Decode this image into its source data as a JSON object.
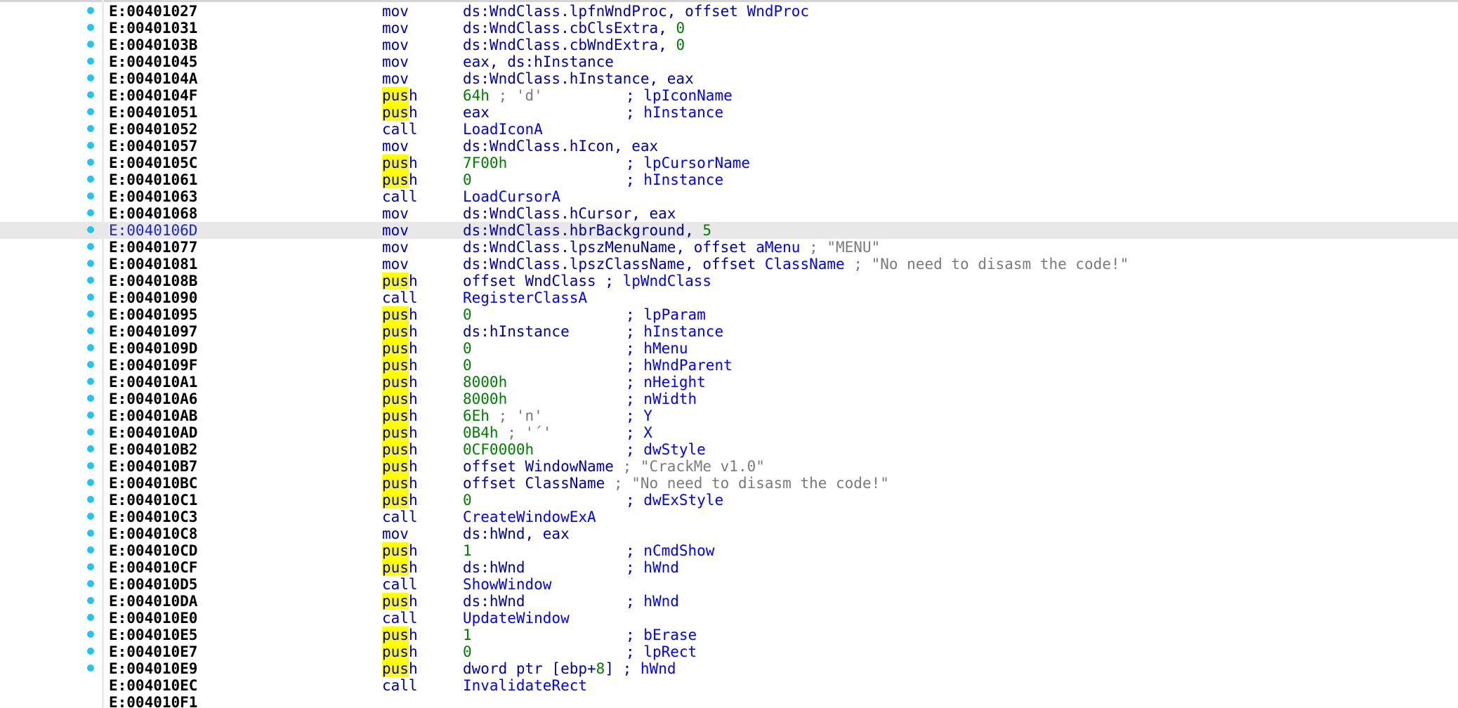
{
  "colors": {
    "background": "#ffffff",
    "selected_row": "#e8e8e8",
    "address": "#000000",
    "selected_address": "#1a25d6",
    "mnemonic": "#0000a8",
    "search_highlight": "#ffff00",
    "number": "#007d00",
    "symbol": "#0000ff",
    "comment": "#7a7a7a",
    "breakpoint_dot": "#23c4f2"
  },
  "highlight_term": "pus",
  "rows": [
    {
      "addr": "E:00401027",
      "dot": true,
      "mn": "mov",
      "ops": [
        [
          "p",
          "ds:WndClass.lpfnWndProc, offset "
        ],
        [
          "s",
          "WndProc"
        ]
      ]
    },
    {
      "addr": "E:00401031",
      "dot": true,
      "mn": "mov",
      "ops": [
        [
          "p",
          "ds:WndClass.cbClsExtra, "
        ],
        [
          "n",
          "0"
        ]
      ]
    },
    {
      "addr": "E:0040103B",
      "dot": true,
      "mn": "mov",
      "ops": [
        [
          "p",
          "ds:WndClass.cbWndExtra, "
        ],
        [
          "n",
          "0"
        ]
      ]
    },
    {
      "addr": "E:00401045",
      "dot": true,
      "mn": "mov",
      "ops": [
        [
          "p",
          "eax, ds:hInstance"
        ]
      ]
    },
    {
      "addr": "E:0040104A",
      "dot": true,
      "mn": "mov",
      "ops": [
        [
          "p",
          "ds:WndClass.hInstance, eax"
        ]
      ]
    },
    {
      "addr": "E:0040104F",
      "dot": true,
      "mn": "push",
      "ops": [
        [
          "n",
          "64h"
        ],
        [
          "g",
          " ; 'd'"
        ]
      ],
      "cmt": [
        [
          "p",
          "; "
        ],
        [
          "s",
          "lpIconName"
        ]
      ]
    },
    {
      "addr": "E:00401051",
      "dot": true,
      "mn": "push",
      "ops": [
        [
          "p",
          "eax"
        ]
      ],
      "cmt": [
        [
          "p",
          "; "
        ],
        [
          "s",
          "hInstance"
        ]
      ]
    },
    {
      "addr": "E:00401052",
      "dot": true,
      "mn": "call",
      "ops": [
        [
          "s",
          "LoadIconA"
        ]
      ]
    },
    {
      "addr": "E:00401057",
      "dot": true,
      "mn": "mov",
      "ops": [
        [
          "p",
          "ds:WndClass.hIcon, eax"
        ]
      ]
    },
    {
      "addr": "E:0040105C",
      "dot": true,
      "mn": "push",
      "ops": [
        [
          "n",
          "7F00h"
        ]
      ],
      "cmt": [
        [
          "p",
          "; "
        ],
        [
          "s",
          "lpCursorName"
        ]
      ]
    },
    {
      "addr": "E:00401061",
      "dot": true,
      "mn": "push",
      "ops": [
        [
          "n",
          "0"
        ]
      ],
      "cmt": [
        [
          "p",
          "; "
        ],
        [
          "s",
          "hInstance"
        ]
      ]
    },
    {
      "addr": "E:00401063",
      "dot": true,
      "mn": "call",
      "ops": [
        [
          "s",
          "LoadCursorA"
        ]
      ]
    },
    {
      "addr": "E:00401068",
      "dot": true,
      "mn": "mov",
      "ops": [
        [
          "p",
          "ds:WndClass.hCursor, eax"
        ]
      ]
    },
    {
      "addr": "E:0040106D",
      "dot": true,
      "selected": true,
      "mn": "mov",
      "ops": [
        [
          "p",
          "ds:WndClass.hbrBackground, "
        ],
        [
          "n",
          "5"
        ]
      ]
    },
    {
      "addr": "E:00401077",
      "dot": true,
      "mn": "mov",
      "ops": [
        [
          "p",
          "ds:WndClass.lpszMenuName, offset "
        ],
        [
          "s",
          "aMenu"
        ],
        [
          "g",
          " ; \"MENU\""
        ]
      ]
    },
    {
      "addr": "E:00401081",
      "dot": true,
      "mn": "mov",
      "ops": [
        [
          "p",
          "ds:WndClass.lpszClassName, offset "
        ],
        [
          "s",
          "ClassName"
        ],
        [
          "g",
          " ; \"No need to disasm the code!\""
        ]
      ]
    },
    {
      "addr": "E:0040108B",
      "dot": true,
      "mn": "push",
      "ops": [
        [
          "p",
          "offset WndClass "
        ],
        [
          "p",
          "; "
        ],
        [
          "s",
          "lpWndClass"
        ]
      ]
    },
    {
      "addr": "E:00401090",
      "dot": true,
      "mn": "call",
      "ops": [
        [
          "s",
          "RegisterClassA"
        ]
      ]
    },
    {
      "addr": "E:00401095",
      "dot": true,
      "mn": "push",
      "ops": [
        [
          "n",
          "0"
        ]
      ],
      "cmt": [
        [
          "p",
          "; "
        ],
        [
          "s",
          "lpParam"
        ]
      ]
    },
    {
      "addr": "E:00401097",
      "dot": true,
      "mn": "push",
      "ops": [
        [
          "p",
          "ds:hInstance"
        ]
      ],
      "cmt": [
        [
          "p",
          "; "
        ],
        [
          "s",
          "hInstance"
        ]
      ]
    },
    {
      "addr": "E:0040109D",
      "dot": true,
      "mn": "push",
      "ops": [
        [
          "n",
          "0"
        ]
      ],
      "cmt": [
        [
          "p",
          "; "
        ],
        [
          "s",
          "hMenu"
        ]
      ]
    },
    {
      "addr": "E:0040109F",
      "dot": true,
      "mn": "push",
      "ops": [
        [
          "n",
          "0"
        ]
      ],
      "cmt": [
        [
          "p",
          "; "
        ],
        [
          "s",
          "hWndParent"
        ]
      ]
    },
    {
      "addr": "E:004010A1",
      "dot": true,
      "mn": "push",
      "ops": [
        [
          "n",
          "8000h"
        ]
      ],
      "cmt": [
        [
          "p",
          "; "
        ],
        [
          "s",
          "nHeight"
        ]
      ]
    },
    {
      "addr": "E:004010A6",
      "dot": true,
      "mn": "push",
      "ops": [
        [
          "n",
          "8000h"
        ]
      ],
      "cmt": [
        [
          "p",
          "; "
        ],
        [
          "s",
          "nWidth"
        ]
      ]
    },
    {
      "addr": "E:004010AB",
      "dot": true,
      "mn": "push",
      "ops": [
        [
          "n",
          "6Eh"
        ],
        [
          "g",
          " ; 'n'"
        ]
      ],
      "cmt": [
        [
          "p",
          "; "
        ],
        [
          "s",
          "Y"
        ]
      ]
    },
    {
      "addr": "E:004010AD",
      "dot": true,
      "mn": "push",
      "ops": [
        [
          "n",
          "0B4h"
        ],
        [
          "g",
          " ; '´'"
        ]
      ],
      "cmt": [
        [
          "p",
          "; "
        ],
        [
          "s",
          "X"
        ]
      ]
    },
    {
      "addr": "E:004010B2",
      "dot": true,
      "mn": "push",
      "ops": [
        [
          "n",
          "0CF0000h"
        ]
      ],
      "cmt": [
        [
          "p",
          "; "
        ],
        [
          "s",
          "dwStyle"
        ]
      ]
    },
    {
      "addr": "E:004010B7",
      "dot": true,
      "mn": "push",
      "ops": [
        [
          "p",
          "offset WindowName"
        ],
        [
          "g",
          " ; \"CrackMe v1.0\""
        ]
      ]
    },
    {
      "addr": "E:004010BC",
      "dot": true,
      "mn": "push",
      "ops": [
        [
          "p",
          "offset ClassName"
        ],
        [
          "g",
          " ; \"No need to disasm the code!\""
        ]
      ]
    },
    {
      "addr": "E:004010C1",
      "dot": true,
      "mn": "push",
      "ops": [
        [
          "n",
          "0"
        ]
      ],
      "cmt": [
        [
          "p",
          "; "
        ],
        [
          "s",
          "dwExStyle"
        ]
      ]
    },
    {
      "addr": "E:004010C3",
      "dot": true,
      "mn": "call",
      "ops": [
        [
          "s",
          "CreateWindowExA"
        ]
      ]
    },
    {
      "addr": "E:004010C8",
      "dot": true,
      "mn": "mov",
      "ops": [
        [
          "p",
          "ds:hWnd, eax"
        ]
      ]
    },
    {
      "addr": "E:004010CD",
      "dot": true,
      "mn": "push",
      "ops": [
        [
          "n",
          "1"
        ]
      ],
      "cmt": [
        [
          "p",
          "; "
        ],
        [
          "s",
          "nCmdShow"
        ]
      ]
    },
    {
      "addr": "E:004010CF",
      "dot": true,
      "mn": "push",
      "ops": [
        [
          "p",
          "ds:hWnd"
        ]
      ],
      "cmt": [
        [
          "p",
          "; "
        ],
        [
          "s",
          "hWnd"
        ]
      ]
    },
    {
      "addr": "E:004010D5",
      "dot": true,
      "mn": "call",
      "ops": [
        [
          "s",
          "ShowWindow"
        ]
      ]
    },
    {
      "addr": "E:004010DA",
      "dot": true,
      "mn": "push",
      "ops": [
        [
          "p",
          "ds:hWnd"
        ]
      ],
      "cmt": [
        [
          "p",
          "; "
        ],
        [
          "s",
          "hWnd"
        ]
      ]
    },
    {
      "addr": "E:004010E0",
      "dot": true,
      "mn": "call",
      "ops": [
        [
          "s",
          "UpdateWindow"
        ]
      ]
    },
    {
      "addr": "E:004010E5",
      "dot": true,
      "mn": "push",
      "ops": [
        [
          "n",
          "1"
        ]
      ],
      "cmt": [
        [
          "p",
          "; "
        ],
        [
          "s",
          "bErase"
        ]
      ]
    },
    {
      "addr": "E:004010E7",
      "dot": true,
      "mn": "push",
      "ops": [
        [
          "n",
          "0"
        ]
      ],
      "cmt": [
        [
          "p",
          "; "
        ],
        [
          "s",
          "lpRect"
        ]
      ]
    },
    {
      "addr": "E:004010E9",
      "dot": true,
      "mn": "push",
      "ops": [
        [
          "p",
          "dword ptr [ebp+"
        ],
        [
          "n",
          "8"
        ],
        [
          "p",
          "] "
        ],
        [
          "p",
          "; "
        ],
        [
          "s",
          "hWnd"
        ]
      ]
    },
    {
      "addr": "E:004010EC",
      "dot": false,
      "mn": "call",
      "ops": [
        [
          "s",
          "InvalidateRect"
        ]
      ]
    },
    {
      "addr": "E:004010F1",
      "dot": false,
      "mn": "",
      "ops": []
    }
  ]
}
